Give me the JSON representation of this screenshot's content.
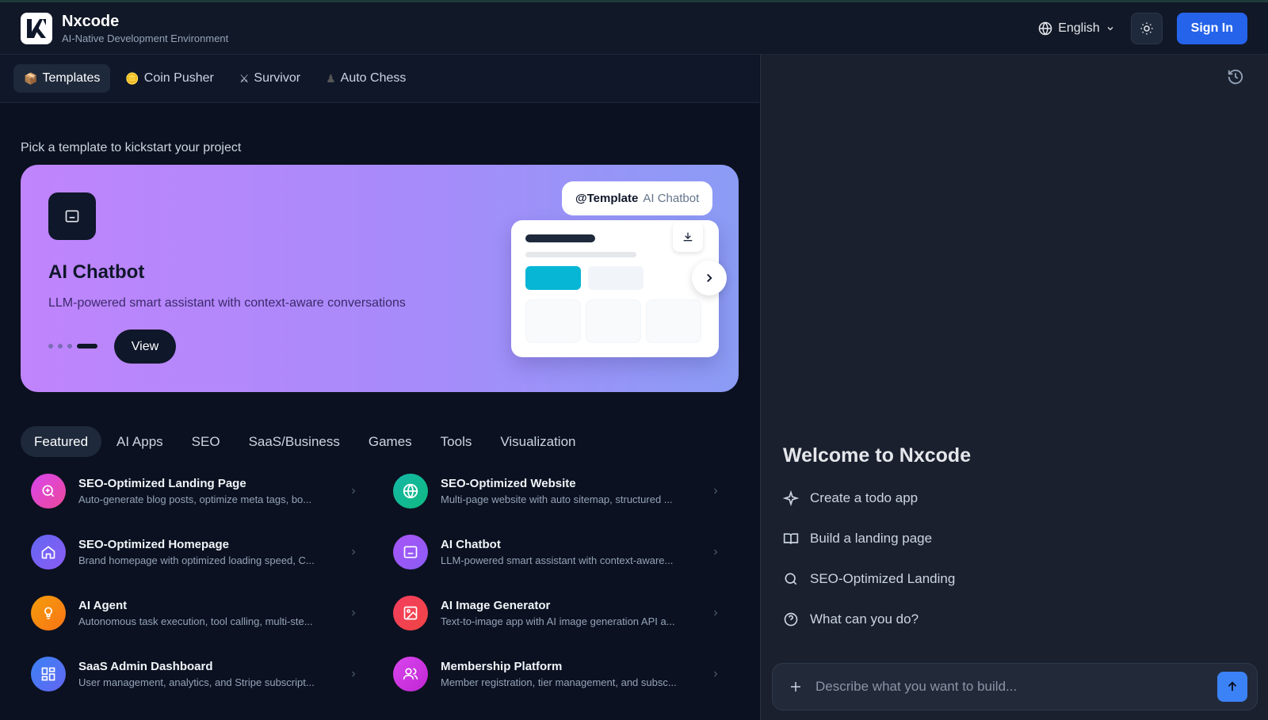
{
  "header": {
    "brand_name": "Nxcode",
    "tagline": "AI-Native Development Environment",
    "language": "English",
    "signin_label": "Sign In"
  },
  "tabs": [
    {
      "icon": "📦",
      "label": "Templates",
      "active": true
    },
    {
      "icon": "🪙",
      "label": "Coin Pusher"
    },
    {
      "icon": "⚔",
      "label": "Survivor"
    },
    {
      "icon": "♟",
      "label": "Auto Chess"
    }
  ],
  "main": {
    "subtitle": "Pick a template to kickstart your project",
    "hero": {
      "title": "AI Chatbot",
      "description": "LLM-powered smart assistant with context-aware conversations",
      "view_label": "View",
      "template_tag": "@Template",
      "template_name": "AI Chatbot",
      "slides": 4,
      "active_slide": 4
    },
    "categories": [
      "Featured",
      "AI Apps",
      "SEO",
      "SaaS/Business",
      "Games",
      "Tools",
      "Visualization"
    ],
    "active_category": "Featured",
    "items": [
      {
        "title": "SEO-Optimized Landing Page",
        "desc": "Auto-generate blog posts, optimize meta tags, bo...",
        "icon": "search-plus-icon",
        "color": "#d946ef"
      },
      {
        "title": "SEO-Optimized Website",
        "desc": "Multi-page website with auto sitemap, structured ...",
        "icon": "globe-icon",
        "color": "#14b8a6"
      },
      {
        "title": "SEO-Optimized Homepage",
        "desc": "Brand homepage with optimized loading speed, C...",
        "icon": "home-icon",
        "color": "#6366f1"
      },
      {
        "title": "AI Chatbot",
        "desc": "LLM-powered smart assistant with context-aware...",
        "icon": "chat-icon",
        "color": "#a855f7"
      },
      {
        "title": "AI Agent",
        "desc": "Autonomous task execution, tool calling, multi-ste...",
        "icon": "lightbulb-icon",
        "color": "#f59e0b"
      },
      {
        "title": "AI Image Generator",
        "desc": "Text-to-image app with AI image generation API a...",
        "icon": "image-icon",
        "color": "#f43f5e"
      },
      {
        "title": "SaaS Admin Dashboard",
        "desc": "User management, analytics, and Stripe subscript...",
        "icon": "dashboard-icon",
        "color": "#3b82f6"
      },
      {
        "title": "Membership Platform",
        "desc": "Member registration, tier management, and subsc...",
        "icon": "users-icon",
        "color": "#d946ef"
      }
    ]
  },
  "chat": {
    "welcome": "Welcome to Nxcode",
    "suggestions": [
      {
        "icon": "sparkle-icon",
        "label": "Create a todo app"
      },
      {
        "icon": "book-icon",
        "label": "Build a landing page"
      },
      {
        "icon": "search-icon",
        "label": "SEO-Optimized Landing"
      },
      {
        "icon": "help-circle-icon",
        "label": "What can you do?"
      }
    ],
    "input_placeholder": "Describe what you want to build..."
  },
  "colors": {
    "accent": "#2563eb",
    "hero_gradient_start": "#c084fc",
    "hero_gradient_end": "#8b9cf5"
  }
}
